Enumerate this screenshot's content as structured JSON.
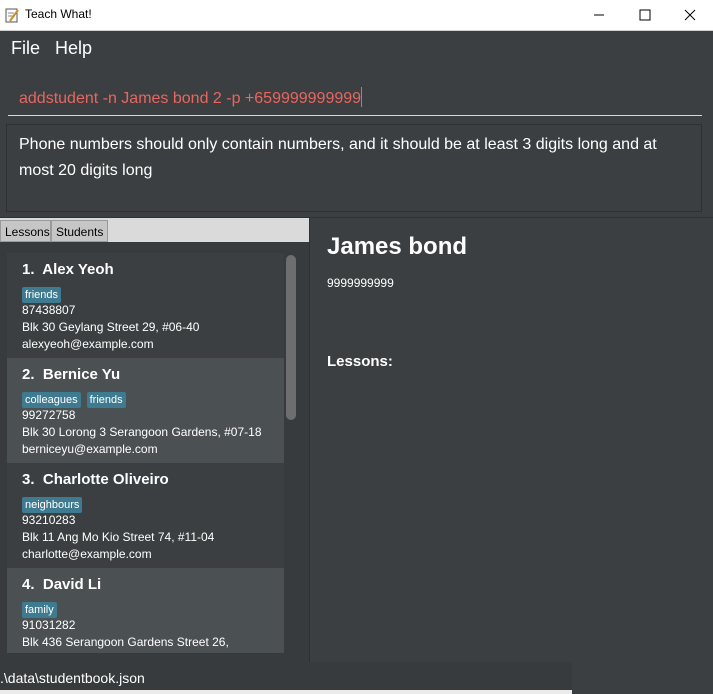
{
  "window": {
    "title": "Teach What!",
    "app_icon": "notepad-pencil-icon",
    "controls": [
      "minimize-icon",
      "maximize-icon",
      "close-icon"
    ]
  },
  "menu": {
    "items": [
      {
        "label": "File"
      },
      {
        "label": "Help"
      }
    ]
  },
  "command": {
    "value": "addstudent -n James bond 2 -p +659999999999",
    "text_color": "#e8665f"
  },
  "result": {
    "message": "Phone numbers should only contain numbers, and it should be at least 3 digits long and at most 20 digits long"
  },
  "tabs": [
    {
      "label": "Lessons"
    },
    {
      "label": "Students"
    }
  ],
  "students": [
    {
      "index": "1.",
      "name": "Alex Yeoh",
      "tags": [
        "friends"
      ],
      "phone": "87438807",
      "address": "Blk 30 Geylang Street 29, #06-40",
      "email": "alexyeoh@example.com"
    },
    {
      "index": "2.",
      "name": "Bernice Yu",
      "tags": [
        "colleagues",
        "friends"
      ],
      "phone": "99272758",
      "address": "Blk 30 Lorong 3 Serangoon Gardens, #07-18",
      "email": "berniceyu@example.com"
    },
    {
      "index": "3.",
      "name": "Charlotte Oliveiro",
      "tags": [
        "neighbours"
      ],
      "phone": "93210283",
      "address": "Blk 11 Ang Mo Kio Street 74, #11-04",
      "email": "charlotte@example.com"
    },
    {
      "index": "4.",
      "name": "David Li",
      "tags": [
        "family"
      ],
      "phone": "91031282",
      "address": "Blk 436 Serangoon Gardens Street 26,",
      "email": ""
    }
  ],
  "detail": {
    "name": "James bond",
    "phone": "9999999999",
    "lessons_label": "Lessons:"
  },
  "status": {
    "path": ".\\data\\studentbook.json"
  },
  "colors": {
    "background": "#3c3f41",
    "tag": "#3e7b91",
    "card_alt": "#4b5052"
  }
}
